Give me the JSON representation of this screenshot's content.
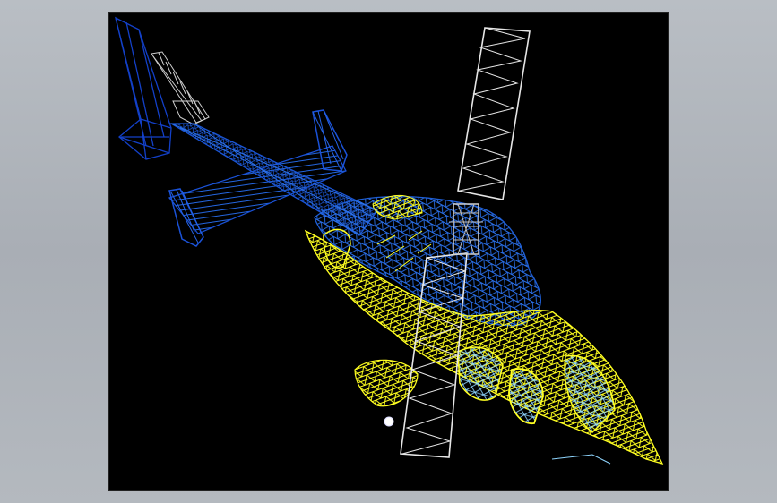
{
  "scene": {
    "subject": "helicopter-wireframe",
    "background_color": "#000000",
    "outer_background_color": "#b3b8be"
  },
  "colors": {
    "body_upper": "#1f5fd6",
    "body_upper_dark": "#0b2f9e",
    "body_lower": "#ffff22",
    "rotor": "#e9e9e9",
    "glass": "#7fd0ff",
    "hub": "#cfcfcf"
  },
  "parts": {
    "tail_fin": "tail-fin",
    "horizontal_stabilizer": "horizontal-stabilizer",
    "tail_boom": "tail-boom",
    "fuselage": "fuselage",
    "cockpit": "cockpit",
    "main_rotor": "main-rotor",
    "tail_rotor": "tail-rotor"
  }
}
